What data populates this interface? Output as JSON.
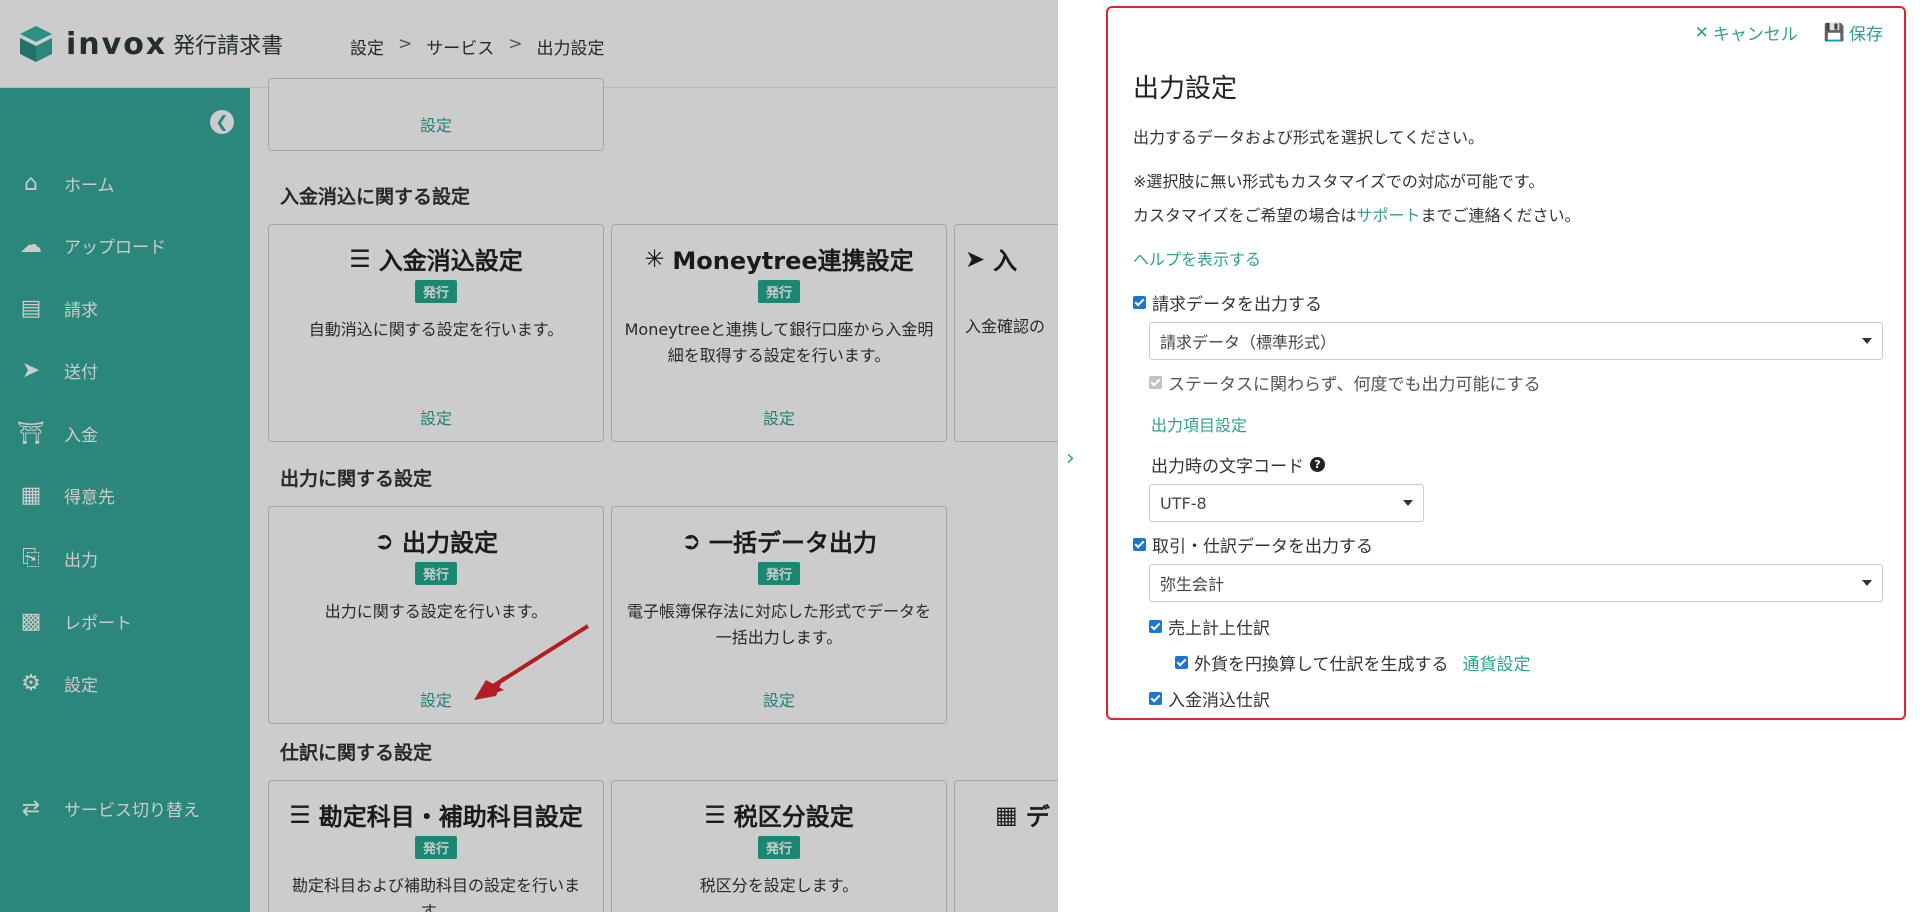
{
  "header": {
    "logo_text": "invox",
    "logo_sub": "発行請求書",
    "breadcrumb": [
      "設定",
      "サービス",
      "出力設定"
    ]
  },
  "sidebar": {
    "items": [
      {
        "label": "ホーム",
        "icon": "home-icon"
      },
      {
        "label": "アップロード",
        "icon": "cloud-upload-icon"
      },
      {
        "label": "請求",
        "icon": "document-icon"
      },
      {
        "label": "送付",
        "icon": "paper-plane-icon"
      },
      {
        "label": "入金",
        "icon": "bank-icon"
      },
      {
        "label": "得意先",
        "icon": "building-icon"
      },
      {
        "label": "出力",
        "icon": "file-export-icon"
      },
      {
        "label": "レポート",
        "icon": "chart-icon"
      },
      {
        "label": "設定",
        "icon": "gear-icon"
      },
      {
        "label": "サービス切り替え",
        "icon": "switch-icon"
      }
    ]
  },
  "content": {
    "top_card_link": "設定",
    "sections": [
      {
        "title": "入金消込に関する設定"
      },
      {
        "title": "出力に関する設定"
      },
      {
        "title": "仕訳に関する設定"
      }
    ],
    "cards": {
      "payment_reconcile": {
        "title": "入金消込設定",
        "badge": "発行",
        "desc": "自動消込に関する設定を行います。",
        "link": "設定"
      },
      "moneytree": {
        "title": "Moneytree連携設定",
        "badge": "発行",
        "desc": "Moneytreeと連携して銀行口座から入金明細を取得する設定を行います。",
        "link": "設定"
      },
      "partial": {
        "title": "入",
        "desc": "入金確認の"
      },
      "output_settings": {
        "title": "出力設定",
        "badge": "発行",
        "desc": "出力に関する設定を行います。",
        "link": "設定"
      },
      "bulk_export": {
        "title": "一括データ出力",
        "badge": "発行",
        "desc": "電子帳簿保存法に対応した形式でデータを一括出力します。",
        "link": "設定"
      },
      "accounts": {
        "title": "勘定科目・補助科目設定",
        "badge": "発行",
        "desc": "勘定科目および補助科目の設定を行いま す。"
      },
      "tax": {
        "title": "税区分設定",
        "badge": "発行",
        "desc": "税区分を設定します。"
      },
      "partial2": {
        "title": "デ"
      }
    }
  },
  "panel": {
    "cancel_label": "キャンセル",
    "save_label": "保存",
    "title": "出力設定",
    "desc": "出力するデータおよび形式を選択してください。",
    "note1": "※選択肢に無い形式もカスタマイズでの対応が可能です。",
    "note2_prefix": "カスタマイズをご希望の場合は",
    "note2_link": "サポート",
    "note2_suffix": "までご連絡ください。",
    "help_link": "ヘルプを表示する",
    "invoice_check_label": "請求データを出力する",
    "invoice_format": "請求データ（標準形式）",
    "status_check_label": "ステータスに関わらず、何度でも出力可能にする",
    "field_settings_link": "出力項目設定",
    "encoding_label": "出力時の文字コード",
    "encoding_value": "UTF-8",
    "journal_check_label": "取引・仕訳データを出力する",
    "journal_format": "弥生会計",
    "sales_journal_label": "売上計上仕訳",
    "fx_label": "外貨を円換算して仕訳を生成する",
    "currency_link": "通貨設定",
    "payment_journal_label": "入金消込仕訳"
  }
}
